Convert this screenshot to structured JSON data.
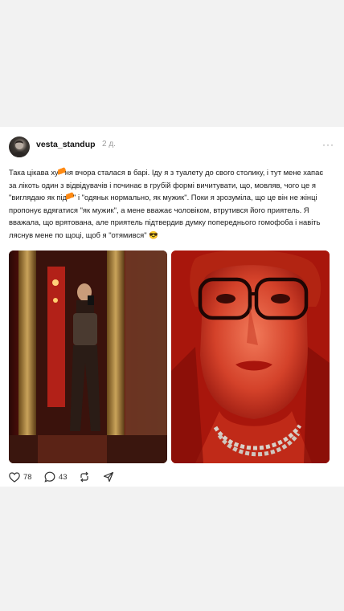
{
  "post": {
    "username": "vesta_standup",
    "time": "2 д.",
    "more": "···",
    "text_parts": [
      "Така цікава ху",
      "ня вчора сталася в барі. Іду я з туалету до свого столику, і тут мене хапає за лікоть один з відвідувачів і починає в грубій формі вичитувати, що, мовляв, чого це я \"виглядаю як під",
      "\" і \"одяньк нормально, як мужик\". Поки я зрозуміла, що це він не жінці пропонує вдягатися \"як мужик\", а мене вважає чоловіком, втрутився його приятель. Я вважала, що врятована, але приятель підтвердив думку попереднього гомофоба і навіть ляснув мене по щоці, щоб я \"отямився\" 😎"
    ],
    "likes": "78",
    "comments": "43"
  },
  "icons": {
    "heart": "heart-icon",
    "comment": "comment-icon",
    "repost": "repost-icon",
    "share": "share-icon",
    "more": "more-icon"
  },
  "colors": {
    "accent_red": "#d6230f",
    "scribble_orange": "#ff8a14"
  }
}
